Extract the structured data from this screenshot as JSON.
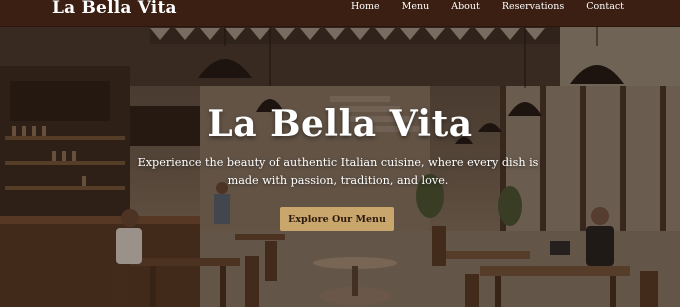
{
  "brand": {
    "name": "La Bella Vita"
  },
  "nav": {
    "items": [
      {
        "label": "Home"
      },
      {
        "label": "Menu"
      },
      {
        "label": "About"
      },
      {
        "label": "Reservations"
      },
      {
        "label": "Contact"
      }
    ]
  },
  "hero": {
    "title": "La Bella Vita",
    "subtitle": "Experience the beauty of authentic Italian cuisine, where every dish is made with passion, tradition, and love.",
    "cta_label": "Explore Our Menu"
  },
  "colors": {
    "nav_bg": "#3a1f12",
    "cta_bg": "#c9a66b",
    "text_light": "#ffffff"
  }
}
